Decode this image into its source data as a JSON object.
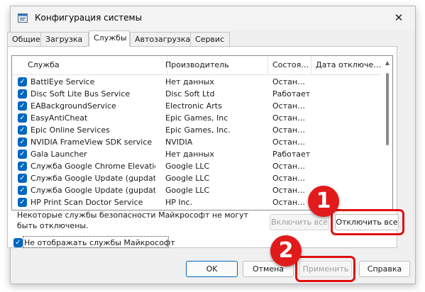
{
  "window": {
    "title": "Конфигурация системы",
    "close_glyph": "✕"
  },
  "tabs": [
    "Общие",
    "Загрузка",
    "Службы",
    "Автозагрузка",
    "Сервис"
  ],
  "table": {
    "columns": [
      "Служба",
      "Производитель",
      "Состоя…",
      "Дата отключе…"
    ],
    "rows": [
      {
        "name": "BattlEye Service",
        "maker": "Нет данных",
        "state": "Остан…",
        "checked": true
      },
      {
        "name": "Disc Soft Lite Bus Service",
        "maker": "Disc Soft Ltd",
        "state": "Работает",
        "checked": true
      },
      {
        "name": "EABackgroundService",
        "maker": "Electronic Arts",
        "state": "Остан…",
        "checked": true
      },
      {
        "name": "EasyAntiCheat",
        "maker": "Epic Games, Inc",
        "state": "Остан…",
        "checked": true
      },
      {
        "name": "Epic Online Services",
        "maker": "Epic Games, Inc.",
        "state": "Остан…",
        "checked": true
      },
      {
        "name": "NVIDIA FrameView SDK service",
        "maker": "NVIDIA",
        "state": "Остан…",
        "checked": true
      },
      {
        "name": "Gala Launcher",
        "maker": "Нет данных",
        "state": "Работает",
        "checked": true
      },
      {
        "name": "Служба Google Chrome Elevation Servic…",
        "maker": "Google LLC",
        "state": "Остан…",
        "checked": true
      },
      {
        "name": "Служба Google Update (gupdate)",
        "maker": "Google LLC",
        "state": "Остан…",
        "checked": true
      },
      {
        "name": "Служба Google Update (gupdatem)",
        "maker": "Google LLC",
        "state": "Остан…",
        "checked": true
      },
      {
        "name": "HP Print Scan Doctor Service",
        "maker": "HP Inc.",
        "state": "Остан…",
        "checked": true
      }
    ],
    "check_glyph": "✓"
  },
  "note": "Некоторые службы безопасности Майкрософт не могут быть отключены.",
  "buttons": {
    "enable_all": "Включить все",
    "disable_all": "Отключить все",
    "ok": "OK",
    "cancel": "Отмена",
    "apply": "Применить",
    "help": "Справка"
  },
  "hide_ms": {
    "label": "Не отображать службы Майкрософт",
    "checked": true
  },
  "annotations": {
    "badge1": "1",
    "badge2": "2"
  },
  "colors": {
    "highlight": "#e01010",
    "accent": "#0067c0"
  }
}
